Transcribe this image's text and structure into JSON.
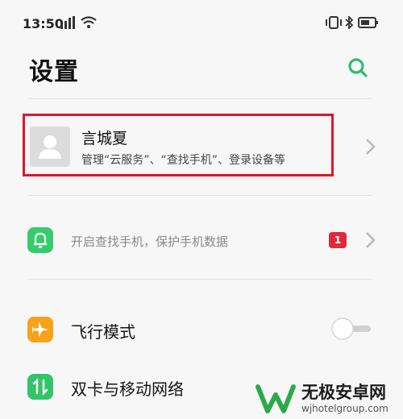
{
  "status_bar": {
    "time": "13:50",
    "icons": [
      "signal-icon",
      "wifi-icon",
      "vibrate-icon",
      "bluetooth-icon",
      "battery-icon"
    ]
  },
  "header": {
    "title": "设置",
    "search_icon": "search-icon"
  },
  "account": {
    "name": "言城夏",
    "description": "管理“云服务”、“查找手机”、登录设备等",
    "highlight_color": "#e1142b"
  },
  "find_phone": {
    "label": "开启查找手机，保护手机数据",
    "badge": "1",
    "icon": "bell-icon",
    "icon_color": "#36cc6b"
  },
  "airplane_mode": {
    "label": "飞行模式",
    "icon": "airplane-icon",
    "icon_color": "#f7a21b",
    "toggle_on": false
  },
  "dual_sim": {
    "label": "双卡与移动网络",
    "icon": "transfer-arrows-icon",
    "icon_color": "#33c46a"
  },
  "watermark": {
    "title": "无极安卓网",
    "url": "wjhotelgroup.com",
    "accent": "#2ea84b"
  },
  "colors": {
    "accent": "#2dbd73",
    "background": "#f7f7f7"
  }
}
